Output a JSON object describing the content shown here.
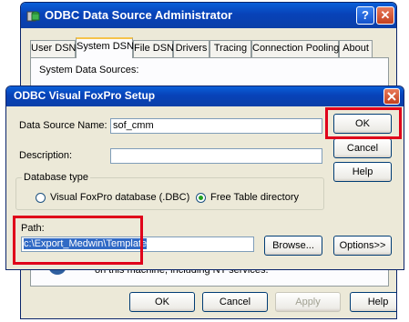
{
  "admin_window": {
    "title": "ODBC Data Source Administrator",
    "help_button": "?",
    "close_button": "✕",
    "tabs": [
      {
        "label": "User DSN"
      },
      {
        "label": "System DSN"
      },
      {
        "label": "File DSN"
      },
      {
        "label": "Drivers"
      },
      {
        "label": "Tracing"
      },
      {
        "label": "Connection Pooling"
      },
      {
        "label": "About"
      }
    ],
    "active_tab": "System DSN",
    "system_sources_label": "System Data Sources:",
    "info_text": "on this machine, including NT services.",
    "buttons": {
      "ok": "OK",
      "cancel": "Cancel",
      "apply": "Apply",
      "help": "Help"
    }
  },
  "setup_dialog": {
    "title": "ODBC Visual FoxPro Setup",
    "data_source_name_label": "Data Source Name:",
    "data_source_name_value": "sof_cmm",
    "description_label": "Description:",
    "description_value": "",
    "database_type": {
      "legend": "Database type",
      "options": [
        "Visual FoxPro database (.DBC)",
        "Free Table directory"
      ],
      "selected": "Free Table directory"
    },
    "path_label": "Path:",
    "path_value": "c:\\Export_Medwin\\Template",
    "buttons": {
      "ok": "OK",
      "cancel": "Cancel",
      "help": "Help",
      "browse": "Browse...",
      "options": "Options>>"
    }
  },
  "colors": {
    "highlight_box": "#e0001a",
    "titlebar": "#0a5fd8",
    "selection": "#316ac5"
  }
}
